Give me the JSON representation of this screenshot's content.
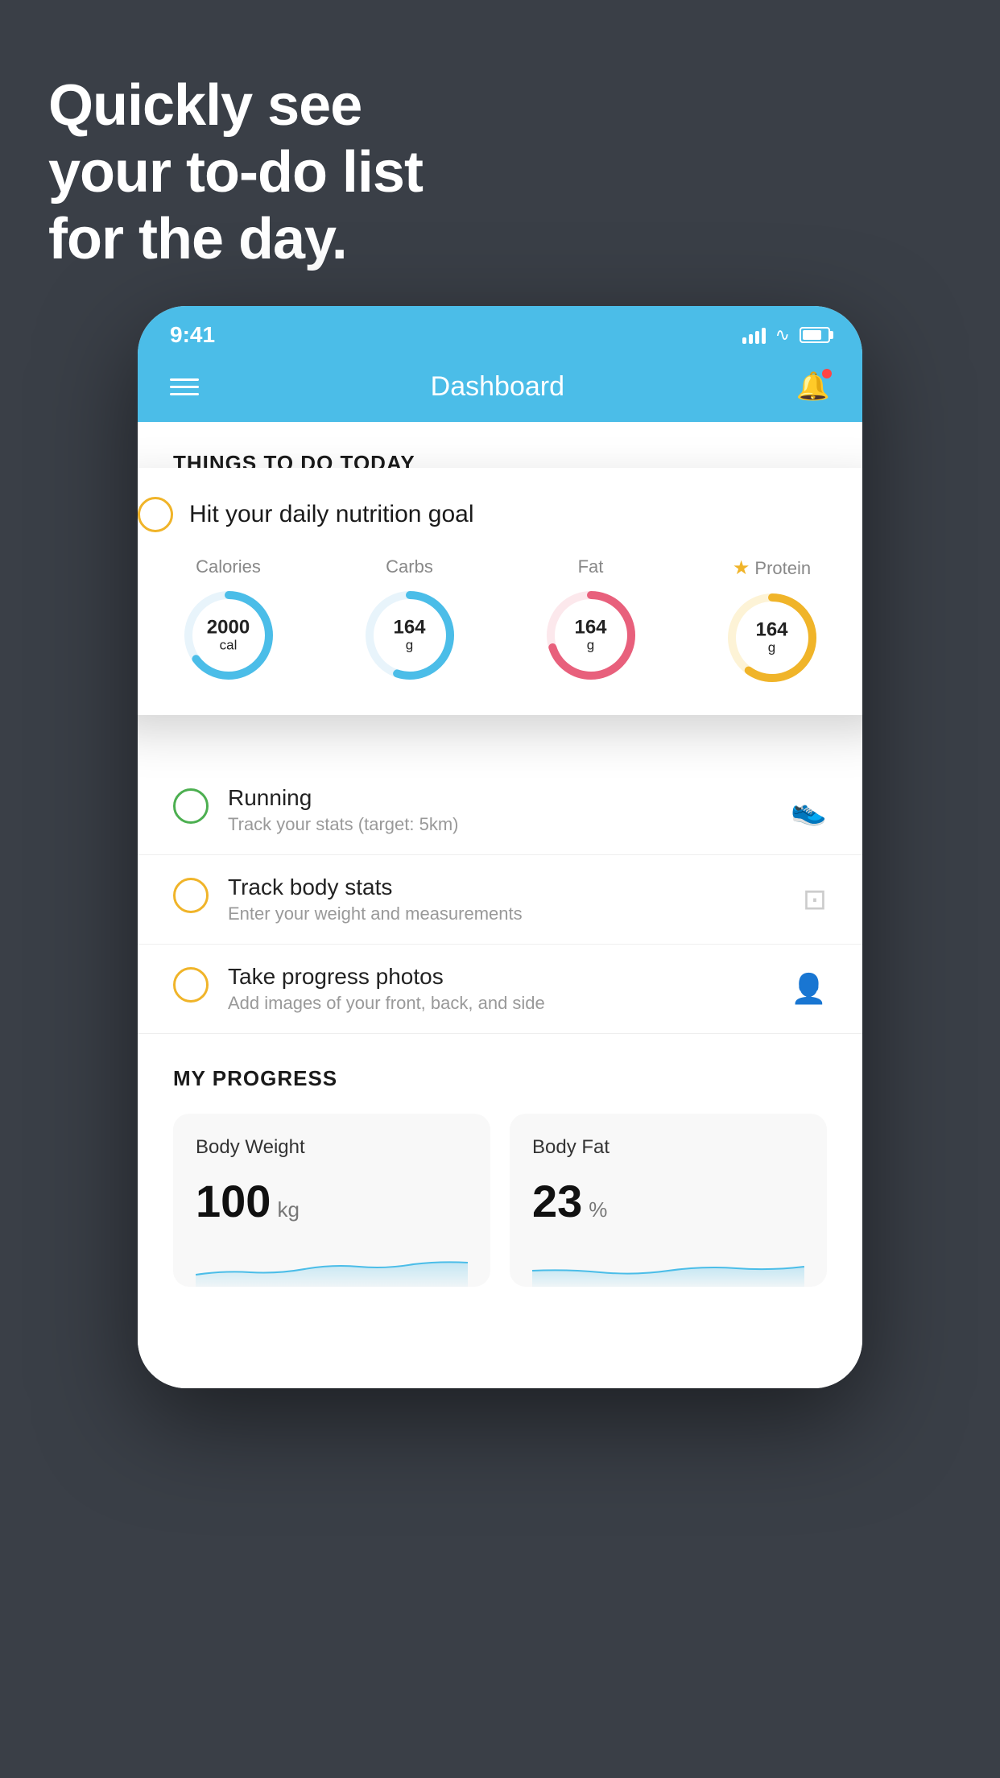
{
  "hero": {
    "line1": "Quickly see",
    "line2": "your to-do list",
    "line3": "for the day."
  },
  "status_bar": {
    "time": "9:41"
  },
  "header": {
    "title": "Dashboard"
  },
  "things_section": {
    "heading": "THINGS TO DO TODAY"
  },
  "nutrition_card": {
    "title": "Hit your daily nutrition goal",
    "items": [
      {
        "label": "Calories",
        "value": "2000",
        "unit": "cal",
        "color": "#4bbde8",
        "pct": 65
      },
      {
        "label": "Carbs",
        "value": "164",
        "unit": "g",
        "color": "#4bbde8",
        "pct": 55
      },
      {
        "label": "Fat",
        "value": "164",
        "unit": "g",
        "color": "#e8607c",
        "pct": 70
      },
      {
        "label": "Protein",
        "value": "164",
        "unit": "g",
        "color": "#f0b429",
        "pct": 60,
        "starred": true
      }
    ]
  },
  "todo_items": [
    {
      "title": "Running",
      "subtitle": "Track your stats (target: 5km)",
      "icon": "shoe",
      "checked": false,
      "color": "green"
    },
    {
      "title": "Track body stats",
      "subtitle": "Enter your weight and measurements",
      "icon": "scale",
      "checked": false,
      "color": "yellow"
    },
    {
      "title": "Take progress photos",
      "subtitle": "Add images of your front, back, and side",
      "icon": "person",
      "checked": false,
      "color": "yellow"
    }
  ],
  "progress_section": {
    "heading": "MY PROGRESS",
    "cards": [
      {
        "title": "Body Weight",
        "value": "100",
        "unit": "kg"
      },
      {
        "title": "Body Fat",
        "value": "23",
        "unit": "%"
      }
    ]
  }
}
